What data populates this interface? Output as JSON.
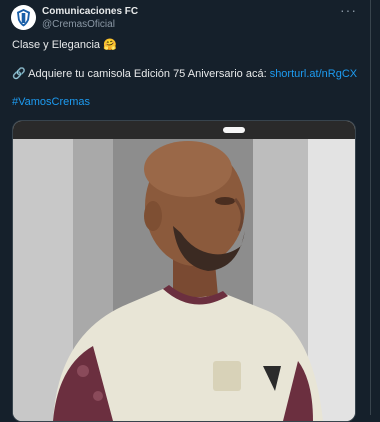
{
  "account": {
    "display_name": "Comunicaciones FC",
    "handle": "@CremasOficial"
  },
  "menu_icon": "more-icon",
  "menu_glyph": "···",
  "post": {
    "line1_text": "Clase y Elegancia",
    "line1_emoji": "🤗",
    "line2_emoji": "🔗",
    "line2_text": "Adquiere tu camisola Edición 75 Aniversario acá:",
    "line2_link": "shorturl.at/nRgCX",
    "hashtag": "#VamosCremas"
  },
  "colors": {
    "background": "#15202b",
    "text": "#e7e9ea",
    "secondary": "#8b98a5",
    "link": "#1d9bf0",
    "jersey_cream": "#e8e5d6",
    "jersey_maroon": "#6b2f3f"
  },
  "icons": [
    "club-crest-avatar",
    "more-icon",
    "link-icon",
    "emoji-hug"
  ]
}
